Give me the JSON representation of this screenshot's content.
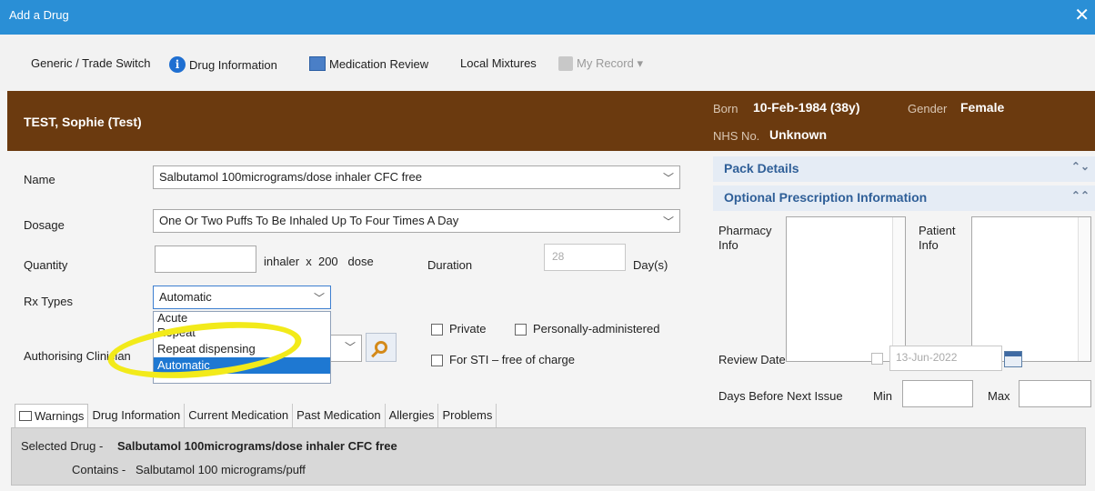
{
  "window": {
    "title": "Add a Drug",
    "close_glyph": "✕"
  },
  "toolbar": {
    "generic_trade": "Generic / Trade Switch",
    "drug_info": "Drug Information",
    "med_review": "Medication Review",
    "local_mixtures": "Local Mixtures",
    "my_record": "My Record ▾"
  },
  "patient": {
    "name": "TEST, Sophie (Test)",
    "born_label": "Born",
    "born_value": "10-Feb-1984 (38y)",
    "gender_label": "Gender",
    "gender_value": "Female",
    "nhs_label": "NHS No.",
    "nhs_value": "Unknown",
    "banner_color": "#6b3a0f"
  },
  "form": {
    "name_label": "Name",
    "name_value": "Salbutamol 100micrograms/dose inhaler CFC free",
    "dosage_label": "Dosage",
    "dosage_value": "One Or Two Puffs To Be Inhaled Up To Four Times A Day",
    "quantity_label": "Quantity",
    "quantity_value": "",
    "quantity_unit": "inhaler  x  200   dose",
    "duration_label": "Duration",
    "duration_value": "28",
    "duration_unit": "Day(s)",
    "rx_types_label": "Rx Types",
    "rx_types_value": "Automatic",
    "rx_options": [
      "Acute",
      "Repeat",
      "Repeat dispensing",
      "Automatic"
    ],
    "authorising_label": "Authorising Clinician",
    "private_label": "Private",
    "personally_label": "Personally-administered",
    "sti_label": "For STI – free of charge"
  },
  "right_panel": {
    "pack_details": "Pack Details",
    "optional_info": "Optional Prescription Information",
    "pharmacy_info": "Pharmacy Info",
    "patient_info": "Patient Info",
    "review_date_label": "Review Date",
    "review_date_value": "13-Jun-2022",
    "days_before_label": "Days Before Next Issue",
    "min_label": "Min",
    "max_label": "Max"
  },
  "tabs": [
    "Warnings",
    "Drug Information",
    "Current Medication",
    "Past Medication",
    "Allergies",
    "Problems"
  ],
  "selected": {
    "selected_label": "Selected Drug -",
    "selected_value": "Salbutamol 100micrograms/dose inhaler CFC free",
    "contains_label": "Contains -",
    "contains_value": "Salbutamol 100 micrograms/puff"
  },
  "colors": {
    "title_bar": "#2a8fd6",
    "highlight_ring": "#f2ea1a",
    "selection": "#1e78d2"
  }
}
